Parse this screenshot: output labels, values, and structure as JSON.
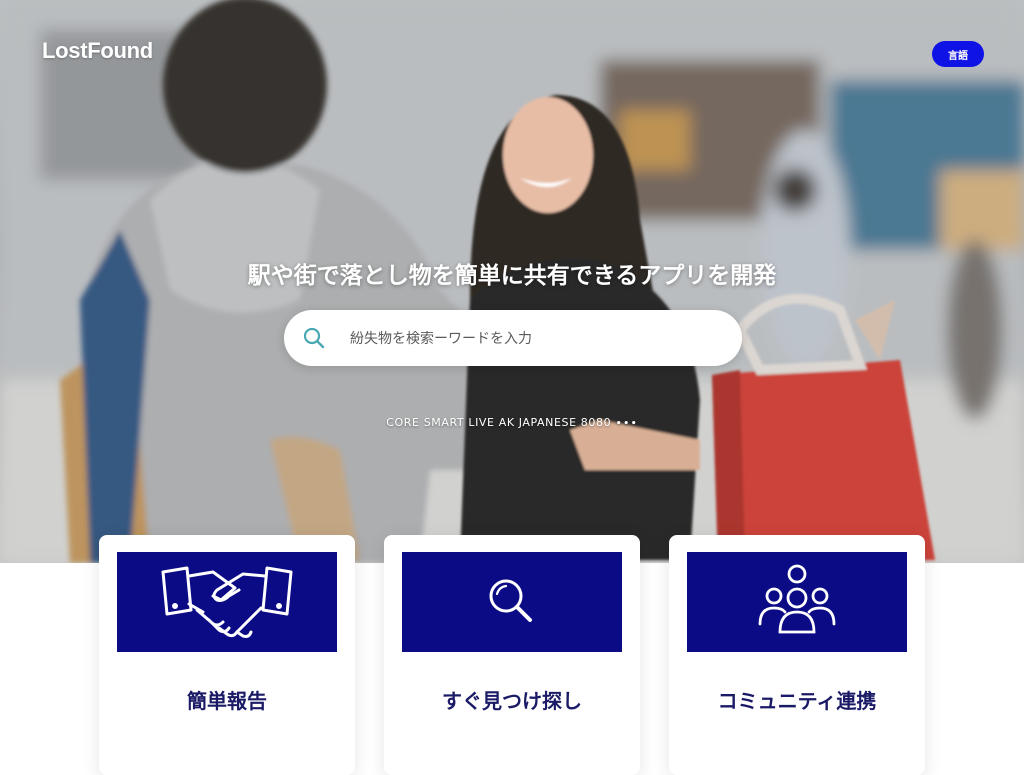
{
  "header": {
    "logo": "LostFound",
    "language_button": "言語"
  },
  "hero": {
    "title": "駅や街で落とし物を簡単に共有できるアプリを開発",
    "search": {
      "placeholder": "紛失物を検索ーワードを入力"
    },
    "note": "CORE SMART LIVE AK JAPANESE 8080 ∙∙∙"
  },
  "cards": [
    {
      "label": "簡単報告",
      "icon": "handshake-icon"
    },
    {
      "label": "すぐ見つけ探し",
      "icon": "magnifier-icon"
    },
    {
      "label": "コミュニティ連携",
      "icon": "community-icon"
    }
  ],
  "colors": {
    "accent_blue": "#0f13e6",
    "card_banner": "#0b0b86",
    "card_label": "#1a1a66",
    "search_icon": "#4aa8b4"
  }
}
